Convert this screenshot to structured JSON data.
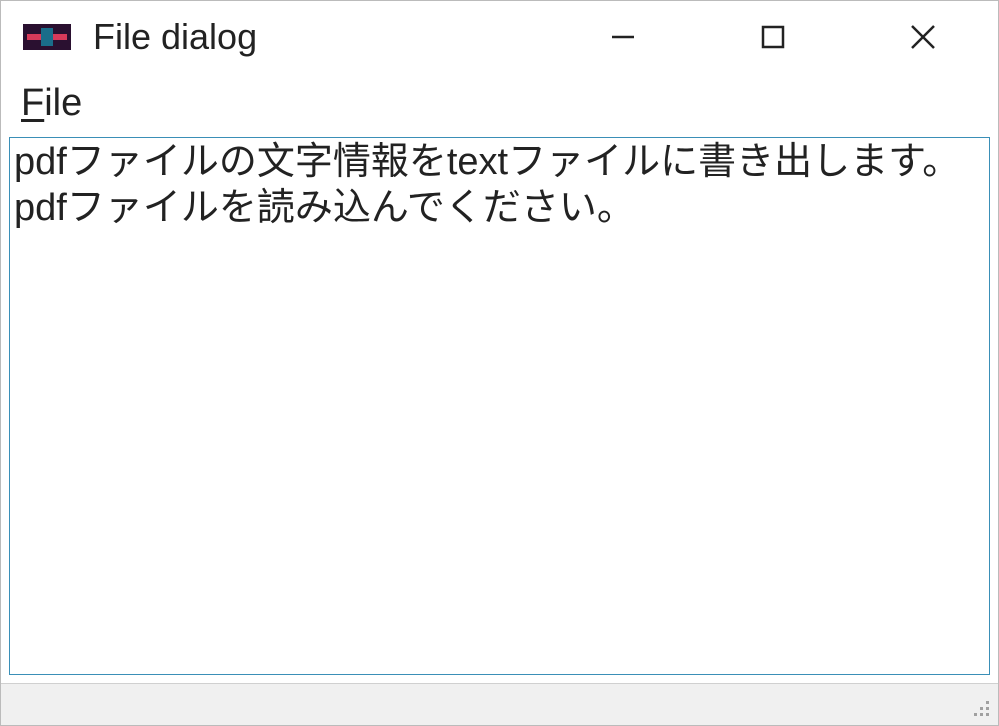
{
  "window": {
    "title": "File dialog"
  },
  "menu": {
    "file_label_prefix": "F",
    "file_label_rest": "ile"
  },
  "textarea": {
    "content": "pdfファイルの文字情報をtextファイルに書き出します。\npdfファイルを読み込んでください。"
  },
  "icons": {
    "app_icon": "app-icon",
    "minimize": "minimize-icon",
    "maximize": "maximize-icon",
    "close": "close-icon",
    "resize_grip": "resize-grip-icon"
  }
}
